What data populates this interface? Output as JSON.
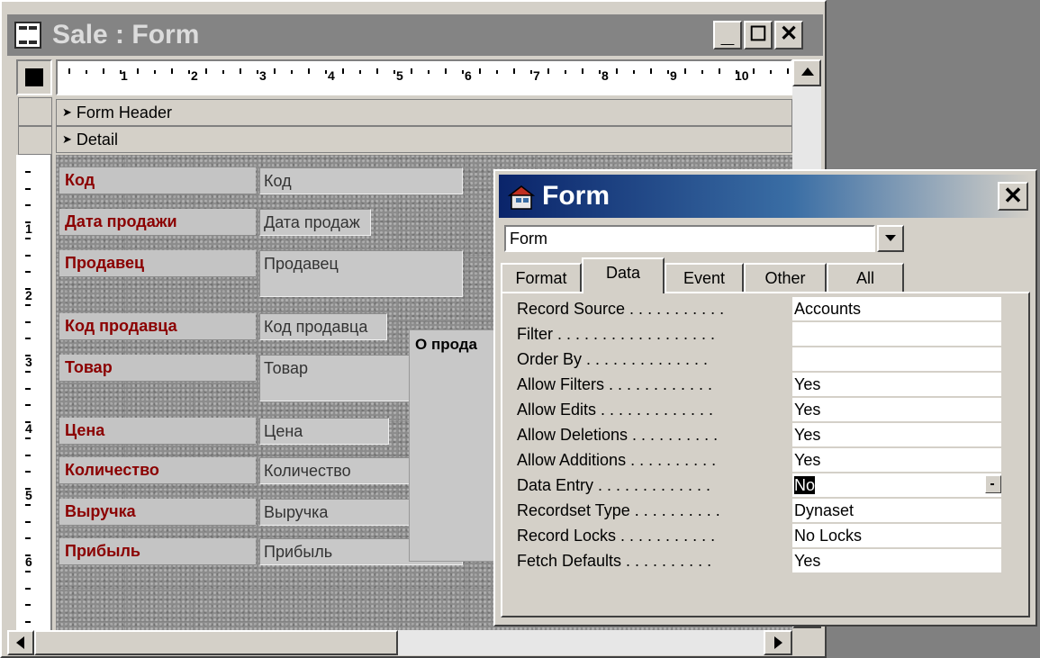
{
  "window": {
    "title": "Sale : Form",
    "minimize": "_",
    "maximize": "☐",
    "close": "✕"
  },
  "ruler": {
    "numbers": [
      "1",
      "2",
      "3",
      "4",
      "5",
      "6",
      "7",
      "8",
      "9",
      "10"
    ],
    "vertical_numbers": [
      "1",
      "2",
      "3",
      "4",
      "5",
      "6"
    ]
  },
  "sections": {
    "form_header": "Form Header",
    "detail": "Detail"
  },
  "fields": [
    {
      "label": "Код",
      "control": "Код"
    },
    {
      "label": "Дата продажи",
      "control": "Дата продаж"
    },
    {
      "label": "Продавец",
      "control": "Продавец"
    },
    {
      "label": "Код продавца",
      "control": "Код продавца"
    },
    {
      "label": "Товар",
      "control": "Товар"
    },
    {
      "label": "Цена",
      "control": "Цена"
    },
    {
      "label": "Количество",
      "control": "Количество"
    },
    {
      "label": "Выручка",
      "control": "Выручка"
    },
    {
      "label": "Прибыль",
      "control": "Прибыль"
    }
  ],
  "subform_label": "О прода",
  "property_sheet": {
    "title": "Form",
    "close": "✕",
    "object": "Form",
    "tabs": [
      "Format",
      "Data",
      "Event",
      "Other",
      "All"
    ],
    "active_tab": "Data",
    "properties": [
      {
        "name": "Record Source . . . . . . . . . . .",
        "value": "Accounts"
      },
      {
        "name": "Filter . . . . . . . . . . . . . . . . . .",
        "value": ""
      },
      {
        "name": "Order By . . . . . . . . . . . . . .",
        "value": ""
      },
      {
        "name": "Allow Filters . . . . . . . . . . . .",
        "value": "Yes"
      },
      {
        "name": "Allow Edits . . . . . . . . . . . . .",
        "value": "Yes"
      },
      {
        "name": "Allow Deletions . . . . . . . . . .",
        "value": "Yes"
      },
      {
        "name": "Allow Additions . . . . . . . . . .",
        "value": "Yes"
      },
      {
        "name": "Data Entry . . . . . . . . . . . . .",
        "value": "No"
      },
      {
        "name": "Recordset Type . . . . . . . . . .",
        "value": "Dynaset"
      },
      {
        "name": "Record Locks . . . . . . . . . . .",
        "value": "No Locks"
      },
      {
        "name": "Fetch Defaults . . . . . . . . . .",
        "value": "Yes"
      }
    ]
  }
}
